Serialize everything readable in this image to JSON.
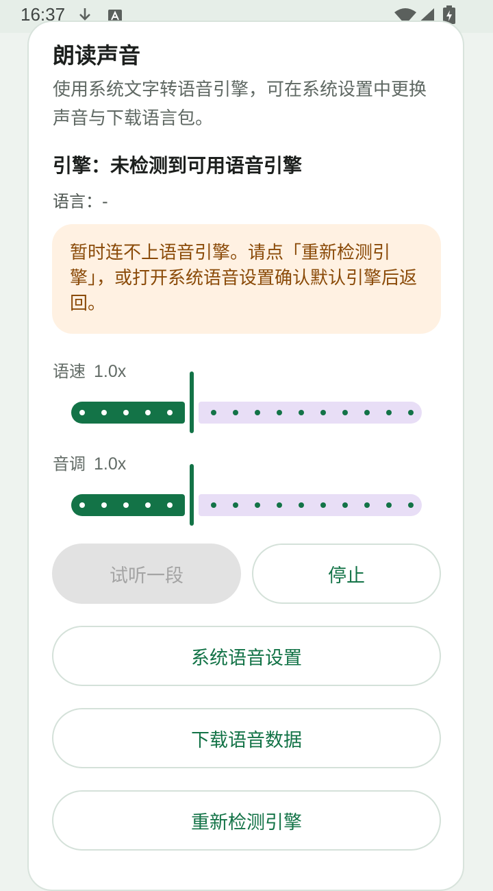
{
  "status_bar": {
    "time": "16:37",
    "icons": [
      "download-icon",
      "a-notification-icon",
      "wifi-icon",
      "signal-icon",
      "battery-charging-icon"
    ]
  },
  "section": {
    "title": "朗读声音",
    "description": "使用系统文字转语音引擎，可在系统设置中更换声音与下载语言包。",
    "engine": "引擎：未检测到可用语音引擎",
    "language": "语言：-",
    "warning": "暂时连不上语音引擎。请点「重新检测引擎」，或打开系统语音设置确认默认引擎后返回。"
  },
  "speed": {
    "label": "语速",
    "value_text": "1.0x",
    "value": 1.0,
    "min": 0.5,
    "max": 2.0,
    "step": 0.1
  },
  "pitch": {
    "label": "音调",
    "value_text": "1.0x",
    "value": 1.0,
    "min": 0.5,
    "max": 2.0,
    "step": 0.1
  },
  "buttons": {
    "preview": "试听一段",
    "stop": "停止",
    "system_settings": "系统语音设置",
    "download": "下载语音数据",
    "recheck": "重新检测引擎"
  },
  "colors": {
    "accent": "#137347",
    "warning_bg": "#fff1e2",
    "warning_text": "#8a4a08",
    "inactive_track": "#e8def6"
  }
}
